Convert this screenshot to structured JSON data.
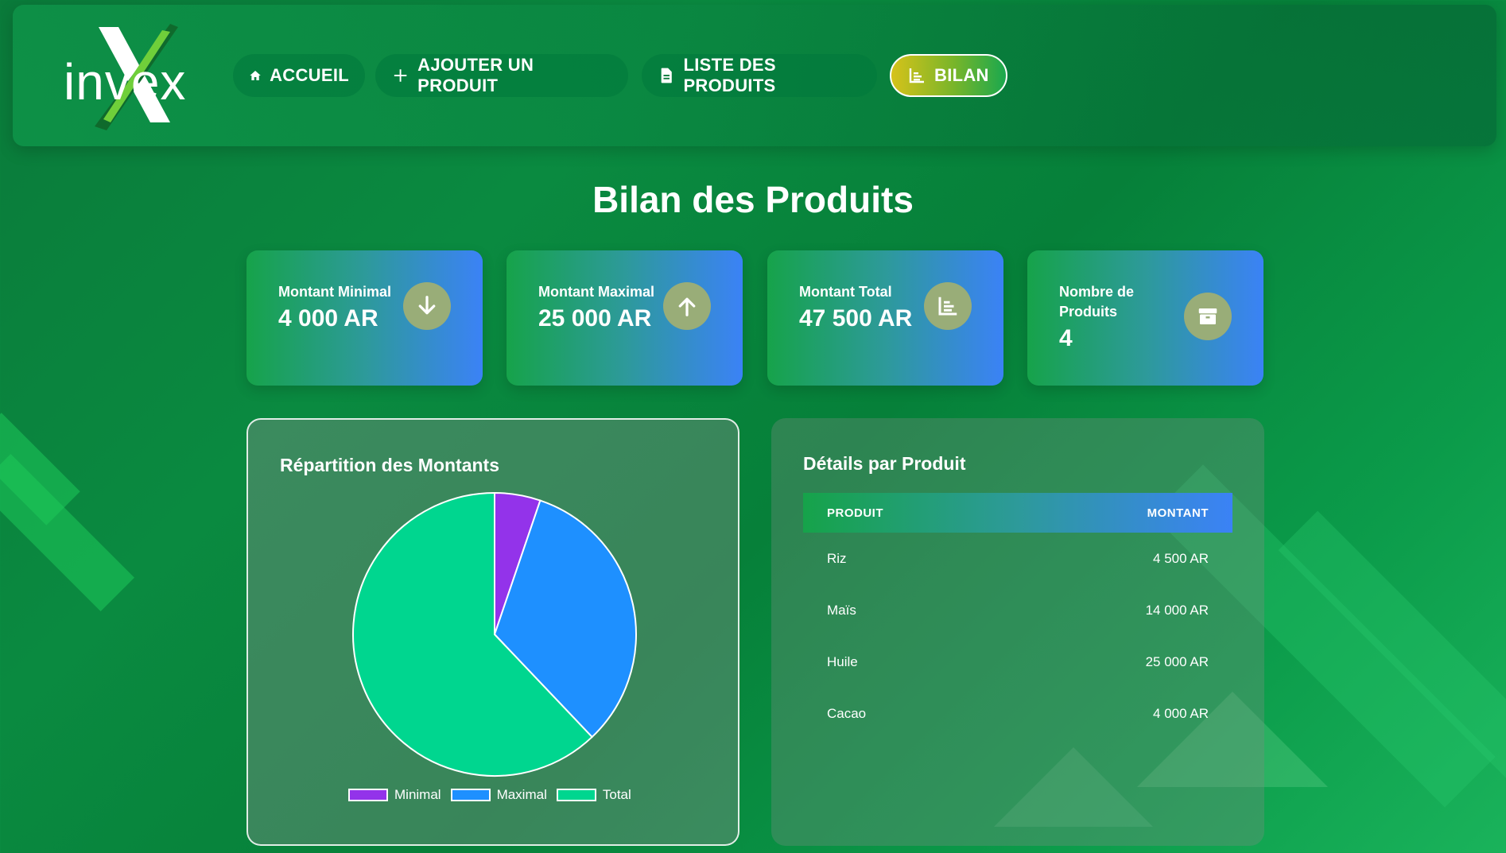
{
  "app": {
    "logo_text": "invex"
  },
  "nav": {
    "items": [
      {
        "label": "ACCUEIL",
        "icon": "home-icon"
      },
      {
        "label": "AJOUTER UN PRODUIT",
        "icon": "plus-icon"
      },
      {
        "label": "LISTE DES PRODUITS",
        "icon": "document-icon"
      },
      {
        "label": "BILAN",
        "icon": "chart-icon",
        "active": true
      }
    ]
  },
  "page": {
    "title": "Bilan des Produits"
  },
  "stats": [
    {
      "label": "Montant Minimal",
      "value": "4 000 AR",
      "icon": "arrow-down-icon"
    },
    {
      "label": "Montant Maximal",
      "value": "25 000 AR",
      "icon": "arrow-up-icon"
    },
    {
      "label": "Montant Total",
      "value": "47 500 AR",
      "icon": "chart-icon"
    },
    {
      "label": "Nombre de Produits",
      "value": "4",
      "icon": "box-icon"
    }
  ],
  "chart_panel": {
    "title": "Répartition des Montants"
  },
  "chart_data": {
    "type": "pie",
    "categories": [
      "Minimal",
      "Maximal",
      "Total"
    ],
    "values": [
      4000,
      25000,
      47500
    ],
    "colors": [
      "#9333ea",
      "#1e90ff",
      "#00d68f"
    ],
    "legend_position": "bottom"
  },
  "details_panel": {
    "title": "Détails par Produit",
    "columns": [
      "PRODUIT",
      "MONTANT"
    ],
    "rows": [
      {
        "produit": "Riz",
        "montant": "4 500 AR"
      },
      {
        "produit": "Maïs",
        "montant": "14 000 AR"
      },
      {
        "produit": "Huile",
        "montant": "25 000 AR"
      },
      {
        "produit": "Cacao",
        "montant": "4 000 AR"
      }
    ]
  }
}
